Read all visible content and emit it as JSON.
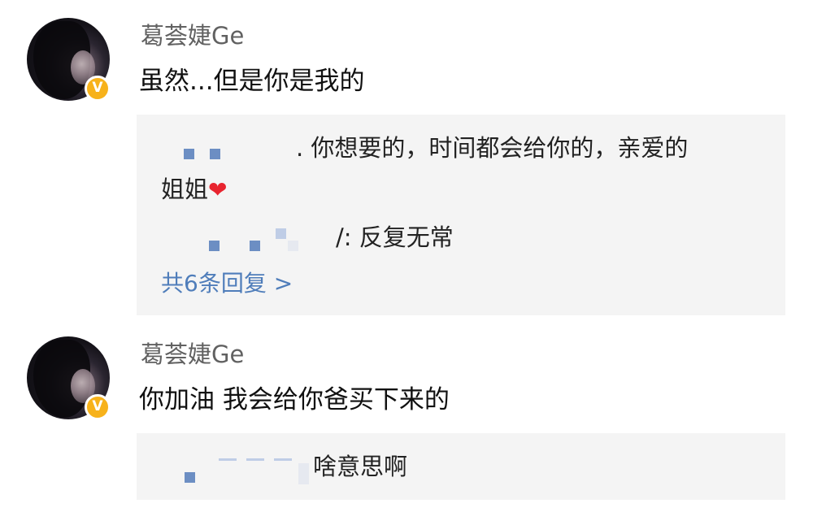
{
  "comments": [
    {
      "username": "葛荟婕Ge",
      "text": "虽然...但是你是我的",
      "replies": [
        {
          "text_line1": ". 你想要的，时间都会给你的，亲爱的",
          "text_line2": "姐姐",
          "emoji": "❤"
        },
        {
          "text": "/: 反复无常"
        }
      ],
      "more_replies": "共6条回复 >"
    },
    {
      "username": "葛荟婕Ge",
      "text": "你加油 我会给你爸买下来的",
      "replies": [
        {
          "text": "啥意思啊"
        }
      ]
    }
  ],
  "badge": "V",
  "colors": {
    "badge": "#f7b21b",
    "link": "#4f7dba",
    "reply_bg": "#f4f4f4",
    "heart": "#e8242f"
  },
  "icons": {
    "verified": "verified-v-badge-icon",
    "heart": "red-heart-emoji-icon"
  }
}
